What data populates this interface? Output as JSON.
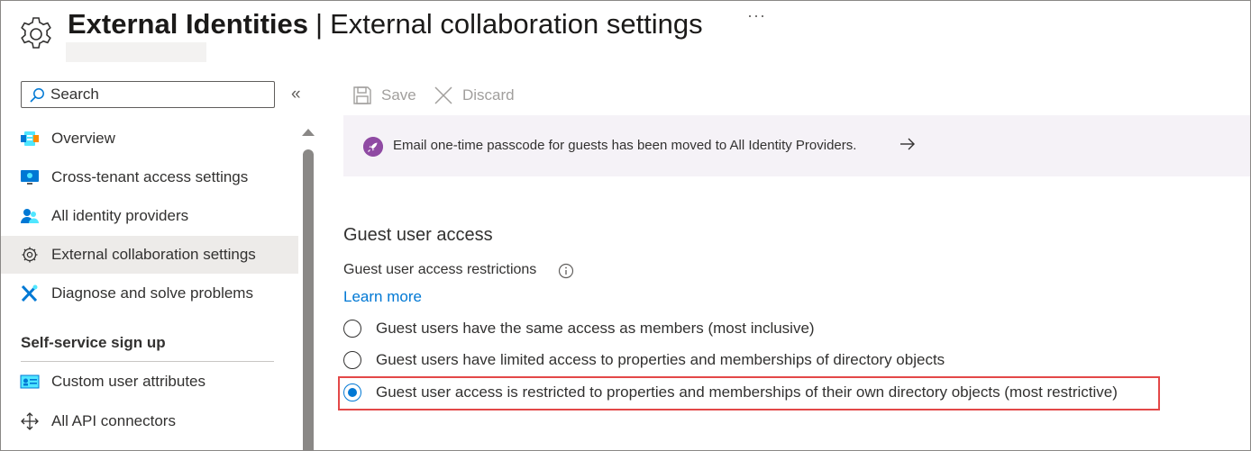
{
  "header": {
    "title_bold": "External Identities",
    "separator": "|",
    "title_rest": "External collaboration settings",
    "more_label": "···",
    "icon": "gear-icon"
  },
  "sidebar": {
    "search_placeholder": "Search",
    "collapse_label": "«",
    "items": [
      {
        "label": "Overview",
        "icon": "overview-icon"
      },
      {
        "label": "Cross-tenant access settings",
        "icon": "monitor-icon"
      },
      {
        "label": "All identity providers",
        "icon": "users-icon"
      },
      {
        "label": "External collaboration settings",
        "icon": "gear-icon",
        "selected": true
      },
      {
        "label": "Diagnose and solve problems",
        "icon": "wrench-icon"
      }
    ],
    "section_title": "Self-service sign up",
    "section_items": [
      {
        "label": "Custom user attributes",
        "icon": "id-card-icon"
      },
      {
        "label": "All API connectors",
        "icon": "move-arrows-icon"
      }
    ]
  },
  "toolbar": {
    "save_label": "Save",
    "discard_label": "Discard"
  },
  "banner": {
    "text": "Email one-time passcode for guests has been moved to All Identity Providers.",
    "icon": "rocket-icon",
    "bg_color": "#f5f2f7"
  },
  "guest_access": {
    "heading": "Guest user access",
    "restrictions_label": "Guest user access restrictions",
    "learn_more": "Learn more",
    "options": [
      {
        "label": "Guest users have the same access as members (most inclusive)",
        "checked": false
      },
      {
        "label": "Guest users have limited access to properties and memberships of directory objects",
        "checked": false
      },
      {
        "label": "Guest user access is restricted to properties and memberships of their own directory objects (most restrictive)",
        "checked": true
      }
    ]
  },
  "colors": {
    "accent": "#0078d4",
    "highlight_border": "#e34848",
    "selected_nav": "#edebe9"
  }
}
